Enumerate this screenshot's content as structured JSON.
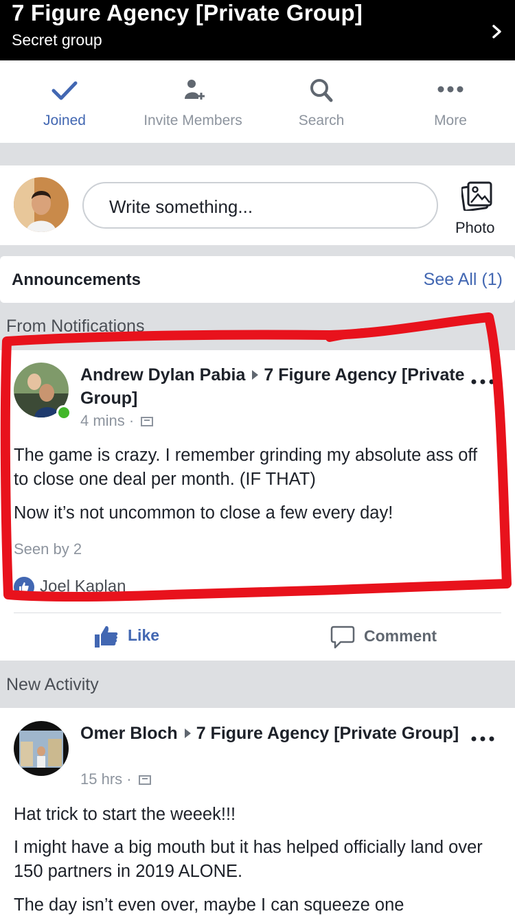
{
  "header": {
    "title": "7 Figure Agency [Private Group]",
    "subtitle": "Secret group",
    "chevron_icon": "chevron-right-icon"
  },
  "actions": [
    {
      "label": "Joined",
      "icon": "checkmark-icon",
      "color": "#4267b2"
    },
    {
      "label": "Invite Members",
      "icon": "add-person-icon",
      "color": "#8d949e"
    },
    {
      "label": "Search",
      "icon": "search-icon",
      "color": "#8d949e"
    },
    {
      "label": "More",
      "icon": "more-dots-icon",
      "color": "#8d949e"
    }
  ],
  "composer": {
    "placeholder": "Write something...",
    "photo_label": "Photo"
  },
  "announcements": {
    "title": "Announcements",
    "see_all": "See All (1)"
  },
  "sections": {
    "notifications": "From Notifications",
    "new_activity": "New Activity"
  },
  "posts": [
    {
      "author": "Andrew Dylan Pabia",
      "group": "7 Figure Agency [Private Group]",
      "time": "4 mins ·",
      "online": true,
      "paragraphs": [
        "The game is crazy. I remember grinding my absolute ass off to close one deal per month. (IF THAT)",
        "Now it’s not uncommon to close a few every day!"
      ],
      "seen_by": "Seen by 2",
      "reactor": "Joel Kaplan",
      "like_label": "Like",
      "comment_label": "Comment"
    },
    {
      "author": "Omer Bloch",
      "group": "7 Figure Agency [Private Group]",
      "time": "15 hrs ·",
      "paragraphs": [
        "Hat trick to start the weeek!!!",
        "I might have a big mouth but it has helped officially land over 150 partners in 2019 ALONE.",
        "The day isn’t even over, maybe I can squeeze one"
      ]
    }
  ],
  "colors": {
    "brand_blue": "#4267b2",
    "header_bg": "#000000",
    "annotation_red": "#e8121c",
    "online_green": "#42b72a"
  }
}
